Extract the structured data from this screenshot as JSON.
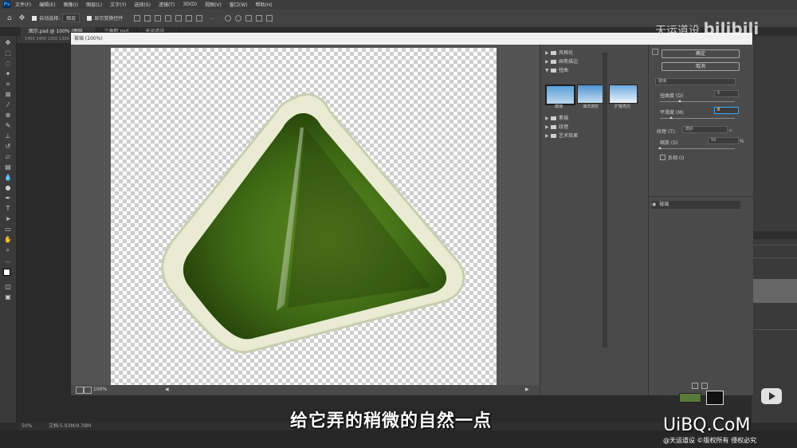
{
  "menubar": {
    "logo": "Ps",
    "items": [
      "文件(F)",
      "编辑(E)",
      "图像(I)",
      "图层(L)",
      "文字(Y)",
      "选择(S)",
      "滤镜(T)",
      "3D(D)",
      "视图(V)",
      "窗口(W)",
      "帮助(H)"
    ]
  },
  "options": {
    "auto_select": "自动选择:",
    "layer_select": "图层",
    "show_transform": "显示变换控件",
    "more": "..."
  },
  "doc_tabs": [
    "图示.psd @ 100% (图层...",
    "三角粽.psd",
    "天运道设 ..."
  ],
  "ruler_text": "1450  1400  1350  1300",
  "dialog": {
    "title": "玻璃 (100%)",
    "zoom": "100%",
    "categories": [
      {
        "label": "风格化",
        "expanded": false
      },
      {
        "label": "画笔描边",
        "expanded": false
      },
      {
        "label": "扭曲",
        "expanded": true
      },
      {
        "label": "素描",
        "expanded": false
      },
      {
        "label": "纹理",
        "expanded": false
      },
      {
        "label": "艺术效果",
        "expanded": false
      }
    ],
    "thumbs": [
      "玻璃",
      "海洋波纹",
      "扩散亮光"
    ],
    "ok": "确定",
    "cancel": "取消",
    "filter_select": "玻璃",
    "distortion_label": "扭曲度 (D)",
    "distortion_value": "5",
    "smoothness_label": "平滑度 (M)",
    "smoothness_value": "8",
    "texture_label": "纹理 (T):",
    "texture_value": "磨砂",
    "scaling_label": "缩放 (S)",
    "scaling_value": "50",
    "scaling_unit": "%",
    "invert_label": "反相 (I)",
    "layer_name": "玻璃"
  },
  "status": {
    "zoom": "50%",
    "doc": "文档:5.93M/9.39M"
  },
  "subtitle": "给它弄的稍微的自然一点",
  "watermark_top": "天运道设",
  "watermark_bili": "bilibili",
  "watermark_uibq": "UiBQ.CoM",
  "watermark_bottom": "@天运道设 ©版权所有 侵权必究",
  "colors": {
    "accent": "#31a8ff",
    "green_dark": "#2e4d12",
    "green_light": "#7fa83a"
  }
}
